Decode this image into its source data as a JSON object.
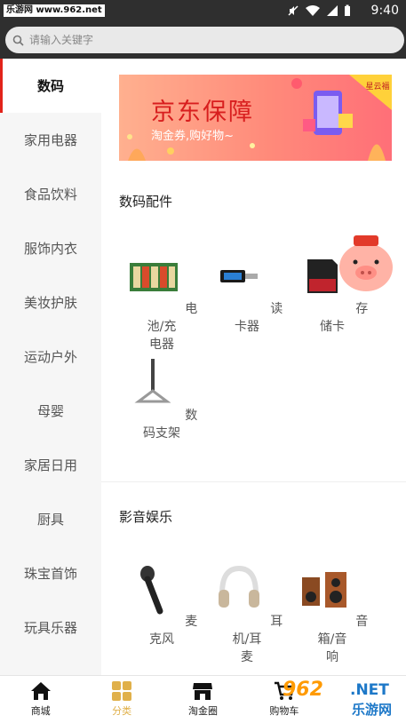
{
  "status_bar": {
    "watermark": "乐游网 www.962.net",
    "time": "9:40"
  },
  "search": {
    "placeholder": "请输入关键字"
  },
  "sidebar": {
    "items": [
      {
        "label": "数码",
        "active": true
      },
      {
        "label": "家用电器"
      },
      {
        "label": "食品饮料"
      },
      {
        "label": "服饰内衣"
      },
      {
        "label": "美妆护肤"
      },
      {
        "label": "运动户外"
      },
      {
        "label": "母婴"
      },
      {
        "label": "家居日用"
      },
      {
        "label": "厨具"
      },
      {
        "label": "珠宝首饰"
      },
      {
        "label": "玩具乐器"
      }
    ]
  },
  "banner": {
    "title": "京东保障",
    "subtitle": "淘金券,购好物~",
    "badge": "星云福"
  },
  "sections": [
    {
      "title": "数码配件",
      "items": [
        {
          "label": "电池/充\n电器",
          "icon": "battery-icon"
        },
        {
          "label": "读卡器",
          "icon": "card-reader-icon"
        },
        {
          "label": "存储卡",
          "icon": "memory-card-icon"
        },
        {
          "label": "数码支架",
          "icon": "stand-icon"
        }
      ]
    },
    {
      "title": "影音娱乐",
      "items": [
        {
          "label": "麦克风",
          "icon": "microphone-icon"
        },
        {
          "label": "耳机/耳\n麦",
          "icon": "headphones-icon"
        },
        {
          "label": "音箱/音\n响",
          "icon": "speaker-icon"
        }
      ]
    }
  ],
  "bottom_nav": [
    {
      "label": "商城",
      "icon": "home-icon"
    },
    {
      "label": "分类",
      "icon": "category-icon",
      "active": true
    },
    {
      "label": "淘金圈",
      "icon": "store-icon"
    },
    {
      "label": "购物车",
      "icon": "cart-icon"
    }
  ],
  "watermark_bottom": {
    "num": "962",
    "net": ".NET",
    "cn": "乐游网"
  },
  "colors": {
    "accent": "#e2231a",
    "nav_active": "#e0b04a",
    "header_bg": "#2f2f2f"
  }
}
